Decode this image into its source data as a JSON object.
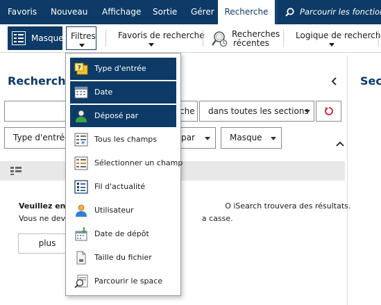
{
  "menubar": {
    "tabs": [
      {
        "label": "Favoris",
        "active": false
      },
      {
        "label": "Nouveau",
        "active": false
      },
      {
        "label": "Affichage",
        "active": false
      },
      {
        "label": "Sortie",
        "active": false
      },
      {
        "label": "Gérer",
        "active": false
      },
      {
        "label": "Recherche",
        "active": true
      }
    ],
    "search_placeholder": "Parcourir les fonctions",
    "search_icon": "magnifier-icon"
  },
  "ribbon": {
    "masque": "Masque",
    "filtres": "Filtres",
    "favoris": "Favoris de recherche",
    "recentes_line1": "Recherches",
    "recentes_line2": "récentes",
    "logique": "Logique de recherche"
  },
  "left_panel": {
    "title": "Recherche",
    "search_suffix": "che",
    "section_select": "dans toutes les sections",
    "filter_type": "Type d'entrée",
    "filter_par": "par",
    "filter_masque": "Masque",
    "msg_line1_bold": "Veuillez entr",
    "msg_line1_rest": "O iSearch trouvera des résultats.",
    "msg_line2_start": "Vous ne deve",
    "msg_line2_rest": "a casse.",
    "plus_button": "plus"
  },
  "right_panel": {
    "title": "Sect"
  },
  "dropdown": {
    "items": [
      {
        "label": "Type d'entrée",
        "selected": true,
        "icon": "entry-type-icon"
      },
      {
        "label": "Date",
        "selected": true,
        "icon": "calendar-icon"
      },
      {
        "label": "Déposé par",
        "selected": true,
        "icon": "person-icon"
      },
      {
        "label": "Tous les champs",
        "selected": false,
        "icon": "all-fields-icon"
      },
      {
        "label": "Sélectionner un champ",
        "selected": false,
        "icon": "select-field-icon"
      },
      {
        "label": "Fil d'actualité",
        "selected": false,
        "icon": "news-feed-icon"
      },
      {
        "label": "Utilisateur",
        "selected": false,
        "icon": "user-icon"
      },
      {
        "label": "Date de dépôt",
        "selected": false,
        "icon": "filing-date-icon"
      },
      {
        "label": "Taille du fichier",
        "selected": false,
        "icon": "file-size-icon"
      },
      {
        "label": "Parcourir le space",
        "selected": false,
        "icon": "browse-space-icon"
      }
    ]
  },
  "colors": {
    "brand": "#0d3a66",
    "reset_red": "#c0272d"
  }
}
